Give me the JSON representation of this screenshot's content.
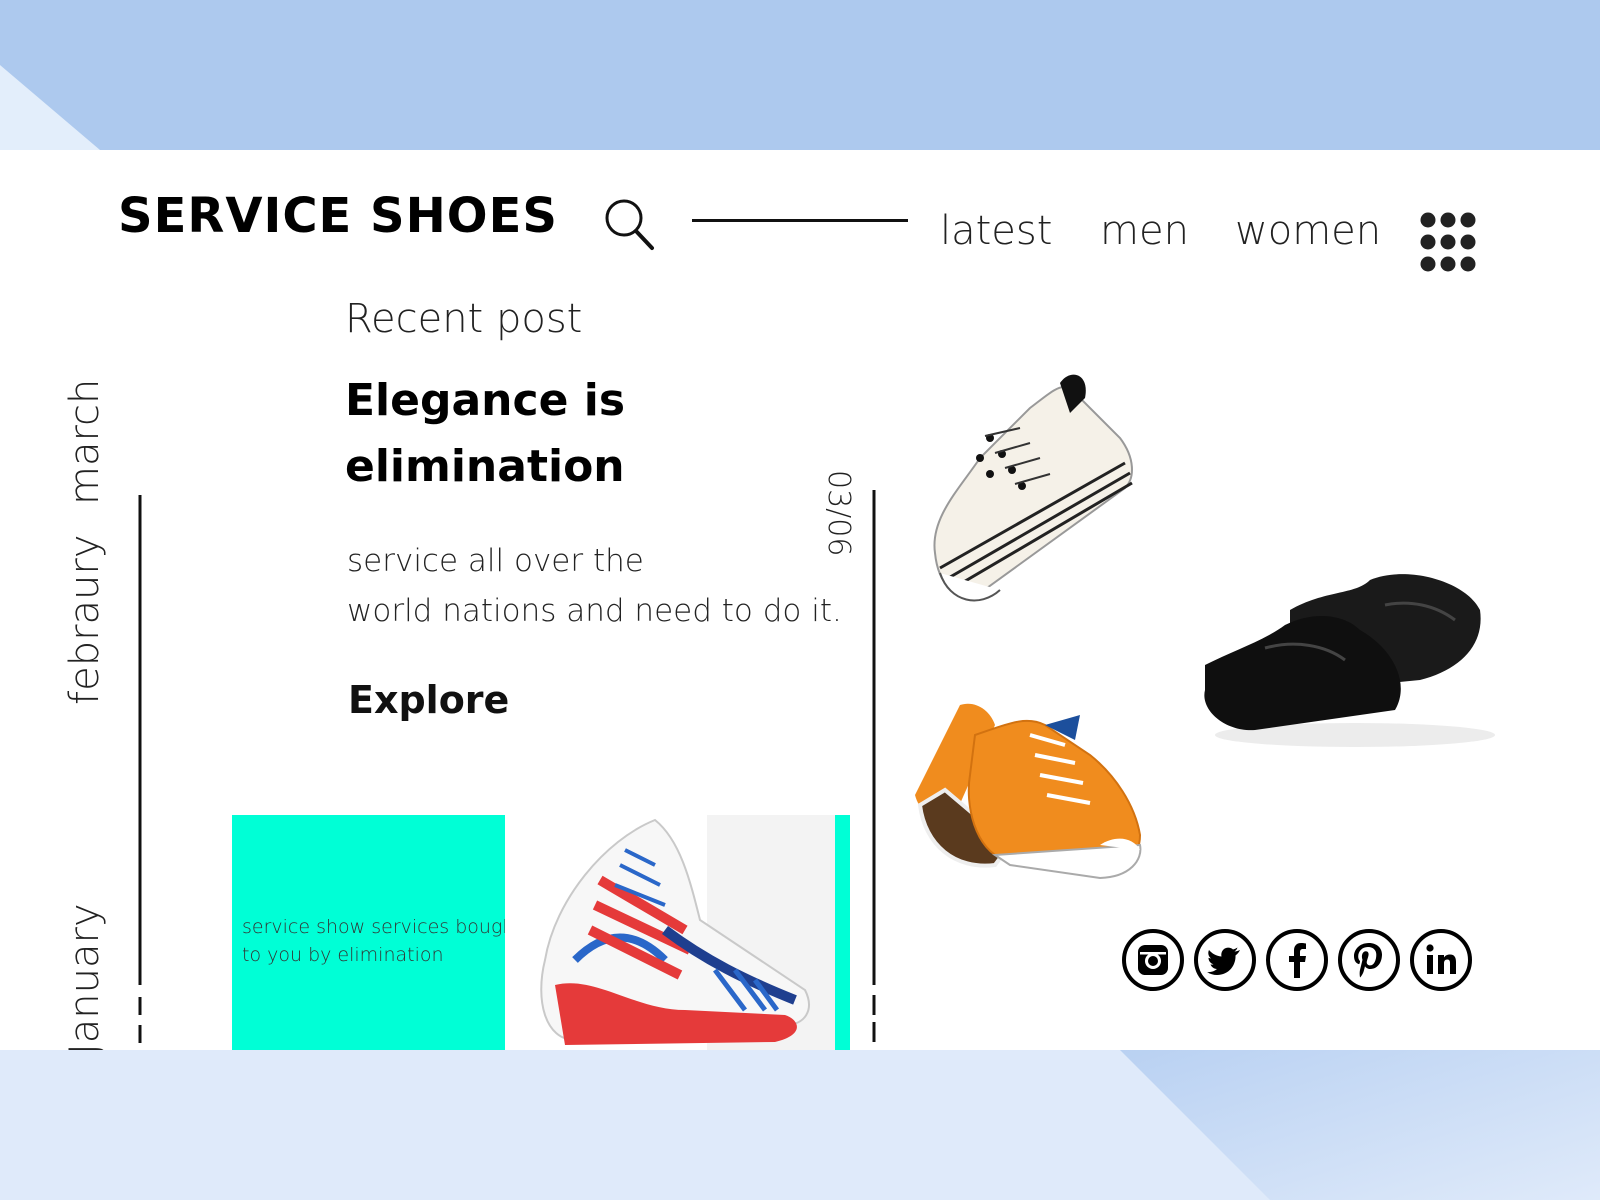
{
  "brand": {
    "name": "SERVICE SHOES"
  },
  "nav": {
    "items": [
      "latest",
      "men",
      "women"
    ]
  },
  "months": [
    "march",
    "febraury",
    "January"
  ],
  "post": {
    "section_label": "Recent post",
    "headline_line1": "Elegance is",
    "headline_line2": "elimination",
    "desc_line1": "service all over the",
    "desc_line2": "world nations and need to do it.",
    "cta": "Explore",
    "date": "03/06"
  },
  "promo": {
    "line1": "service show services bought",
    "line2": "to you by elimination"
  },
  "products": [
    "white-platform-sneaker",
    "black-leather-loafers",
    "orange-canvas-sneakers",
    "running-shoes"
  ],
  "socials": [
    "instagram-icon",
    "twitter-icon",
    "facebook-icon",
    "pinterest-icon",
    "linkedin-icon"
  ],
  "colors": {
    "accent": "#00ffd6",
    "bg_top": "#adc9ee",
    "bg_bottom": "#dfeafa",
    "text": "#000000"
  }
}
